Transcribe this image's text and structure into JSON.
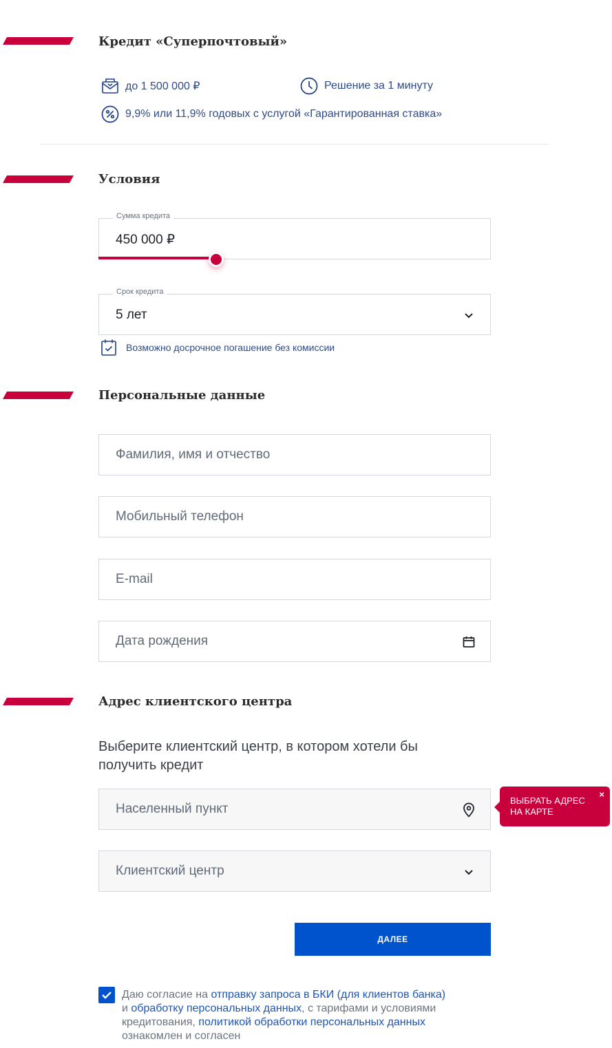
{
  "header": {
    "title": "Кредит «Суперпочтовый»",
    "features": {
      "amount": "до 1 500 000 ₽",
      "decision": "Решение за 1 минуту",
      "rate": "9,9% или 11,9% годовых с услугой «Гарантированная ставка»"
    }
  },
  "conditions": {
    "title": "Условия",
    "amount_label": "Сумма кредита",
    "amount_value": "450 000 ₽",
    "amount_slider_fraction": 0.3,
    "term_label": "Срок кредита",
    "term_value": "5 лет",
    "early_repayment_note": "Возможно досрочное погашение без комиссии"
  },
  "personal": {
    "title": "Персональные данные",
    "full_name_placeholder": "Фамилия, имя и отчество",
    "phone_placeholder": "Мобильный телефон",
    "email_placeholder": "E-mail",
    "birthdate_placeholder": "Дата рождения"
  },
  "address": {
    "title": "Адрес клиентского центра",
    "intro": "Выберите клиентский центр, в котором хотели бы получить кредит",
    "city_placeholder": "Населенный пункт",
    "center_placeholder": "Клиентский центр",
    "map_tooltip_line1": "ВЫБРАТЬ АДРЕС",
    "map_tooltip_line2": "НА КАРТЕ",
    "tooltip_close": "×"
  },
  "actions": {
    "next_label": "ДАЛЕЕ"
  },
  "consent": {
    "checked": true,
    "t1": "Даю согласие на ",
    "l1": "отправку запроса в БКИ (для клиентов банка)",
    "t2": " и ",
    "l2": "обработку персональных данных",
    "t3": ", с тарифами и условиями кредитования, ",
    "l3": "политикой обработки персональных данных",
    "t4": " ознакомлен и согласен"
  },
  "colors": {
    "accent": "#c8003c",
    "primary_button": "#0053cc",
    "link": "#1c55b8"
  },
  "icons": [
    "wallet-envelope-icon",
    "clock-icon",
    "percent-icon",
    "chevron-down-icon",
    "calendar-check-icon",
    "calendar-icon",
    "location-pin-icon",
    "check-icon",
    "close-icon"
  ]
}
